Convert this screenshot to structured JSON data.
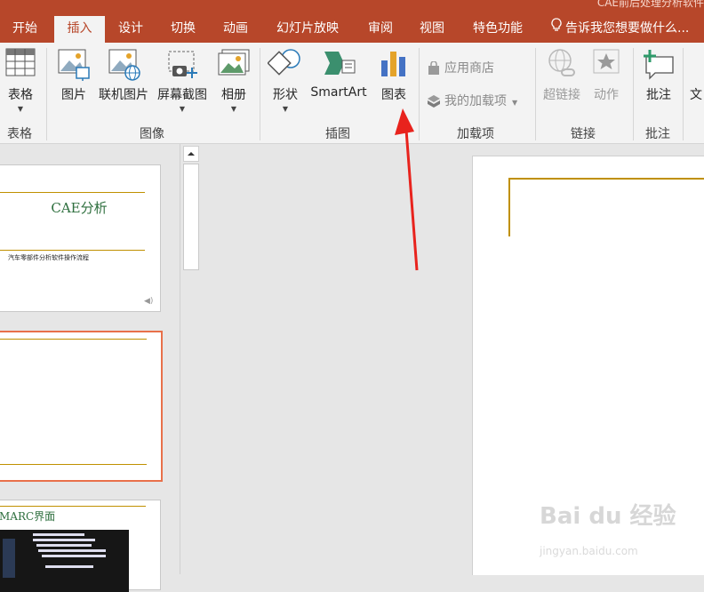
{
  "window": {
    "title": "CAE前后处理分析软件"
  },
  "tabs": [
    {
      "label": "开始"
    },
    {
      "label": "插入"
    },
    {
      "label": "设计"
    },
    {
      "label": "切换"
    },
    {
      "label": "动画"
    },
    {
      "label": "幻灯片放映"
    },
    {
      "label": "审阅"
    },
    {
      "label": "视图"
    },
    {
      "label": "特色功能"
    }
  ],
  "tell_me": "告诉我您想要做什么...",
  "ribbon": {
    "table": "表格",
    "picture": "图片",
    "online_picture": "联机图片",
    "screenshot": "屏幕截图",
    "album": "相册",
    "shapes": "形状",
    "smartart": "SmartArt",
    "chart": "图表",
    "store": "应用商店",
    "my_addins": "我的加载项",
    "hyperlink": "超链接",
    "action": "动作",
    "comment": "批注",
    "text_partial": "文"
  },
  "groups": {
    "tables": "表格",
    "images": "图像",
    "illustrations": "插图",
    "addins": "加载项",
    "links": "链接",
    "comments": "批注"
  },
  "thumbnails": {
    "slide1_title": "CAE分析",
    "slide1_subtitle": "汽车零部件分析软件操作流程",
    "slide3_title": "MARC界面"
  },
  "watermark": {
    "brand": "Bai du 经验",
    "url": "jingyan.baidu.com"
  },
  "colors": {
    "accent": "#b7472a",
    "ribbon_bg": "#f3f3f3",
    "slide_line": "#c09000",
    "selected_slide": "#e8704a"
  }
}
